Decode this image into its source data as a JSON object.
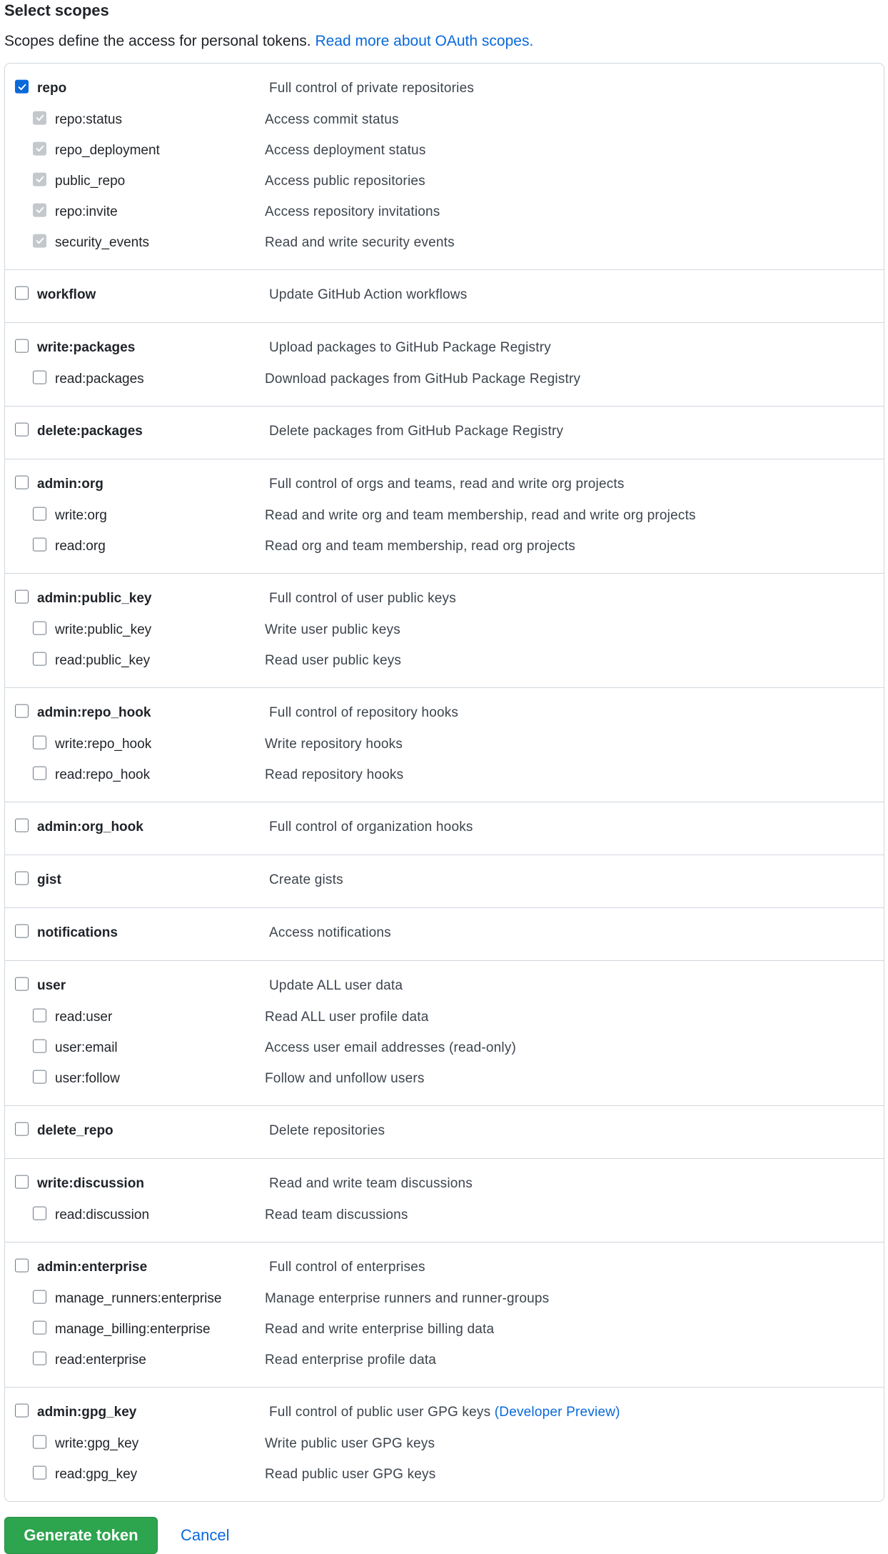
{
  "header": {
    "title": "Select scopes",
    "description": "Scopes define the access for personal tokens.",
    "link_text": "Read more about OAuth scopes."
  },
  "groups": [
    {
      "id": "repo",
      "name": "repo",
      "desc": "Full control of private repositories",
      "checked": true,
      "children": [
        {
          "name": "repo:status",
          "desc": "Access commit status",
          "state": "checked-disabled"
        },
        {
          "name": "repo_deployment",
          "desc": "Access deployment status",
          "state": "checked-disabled"
        },
        {
          "name": "public_repo",
          "desc": "Access public repositories",
          "state": "checked-disabled"
        },
        {
          "name": "repo:invite",
          "desc": "Access repository invitations",
          "state": "checked-disabled"
        },
        {
          "name": "security_events",
          "desc": "Read and write security events",
          "state": "checked-disabled"
        }
      ]
    },
    {
      "id": "workflow",
      "name": "workflow",
      "desc": "Update GitHub Action workflows",
      "checked": false,
      "children": []
    },
    {
      "id": "write-packages",
      "name": "write:packages",
      "desc": "Upload packages to GitHub Package Registry",
      "checked": false,
      "children": [
        {
          "name": "read:packages",
          "desc": "Download packages from GitHub Package Registry",
          "state": "unchecked"
        }
      ]
    },
    {
      "id": "delete-packages",
      "name": "delete:packages",
      "desc": "Delete packages from GitHub Package Registry",
      "checked": false,
      "children": []
    },
    {
      "id": "admin-org",
      "name": "admin:org",
      "desc": "Full control of orgs and teams, read and write org projects",
      "checked": false,
      "children": [
        {
          "name": "write:org",
          "desc": "Read and write org and team membership, read and write org projects",
          "state": "unchecked"
        },
        {
          "name": "read:org",
          "desc": "Read org and team membership, read org projects",
          "state": "unchecked"
        }
      ]
    },
    {
      "id": "admin-public-key",
      "name": "admin:public_key",
      "desc": "Full control of user public keys",
      "checked": false,
      "children": [
        {
          "name": "write:public_key",
          "desc": "Write user public keys",
          "state": "unchecked"
        },
        {
          "name": "read:public_key",
          "desc": "Read user public keys",
          "state": "unchecked"
        }
      ]
    },
    {
      "id": "admin-repo-hook",
      "name": "admin:repo_hook",
      "desc": "Full control of repository hooks",
      "checked": false,
      "children": [
        {
          "name": "write:repo_hook",
          "desc": "Write repository hooks",
          "state": "unchecked"
        },
        {
          "name": "read:repo_hook",
          "desc": "Read repository hooks",
          "state": "unchecked"
        }
      ]
    },
    {
      "id": "admin-org-hook",
      "name": "admin:org_hook",
      "desc": "Full control of organization hooks",
      "checked": false,
      "children": []
    },
    {
      "id": "gist",
      "name": "gist",
      "desc": "Create gists",
      "checked": false,
      "children": []
    },
    {
      "id": "notifications",
      "name": "notifications",
      "desc": "Access notifications",
      "checked": false,
      "children": []
    },
    {
      "id": "user",
      "name": "user",
      "desc": "Update ALL user data",
      "checked": false,
      "children": [
        {
          "name": "read:user",
          "desc": "Read ALL user profile data",
          "state": "unchecked"
        },
        {
          "name": "user:email",
          "desc": "Access user email addresses (read-only)",
          "state": "unchecked"
        },
        {
          "name": "user:follow",
          "desc": "Follow and unfollow users",
          "state": "unchecked"
        }
      ]
    },
    {
      "id": "delete-repo",
      "name": "delete_repo",
      "desc": "Delete repositories",
      "checked": false,
      "children": []
    },
    {
      "id": "write-discussion",
      "name": "write:discussion",
      "desc": "Read and write team discussions",
      "checked": false,
      "children": [
        {
          "name": "read:discussion",
          "desc": "Read team discussions",
          "state": "unchecked"
        }
      ]
    },
    {
      "id": "admin-enterprise",
      "name": "admin:enterprise",
      "desc": "Full control of enterprises",
      "checked": false,
      "children": [
        {
          "name": "manage_runners:enterprise",
          "desc": "Manage enterprise runners and runner-groups",
          "state": "unchecked"
        },
        {
          "name": "manage_billing:enterprise",
          "desc": "Read and write enterprise billing data",
          "state": "unchecked"
        },
        {
          "name": "read:enterprise",
          "desc": "Read enterprise profile data",
          "state": "unchecked"
        }
      ]
    },
    {
      "id": "admin-gpg-key",
      "name": "admin:gpg_key",
      "desc": "Full control of public user GPG keys",
      "desc_link": "(Developer Preview)",
      "checked": false,
      "children": [
        {
          "name": "write:gpg_key",
          "desc": "Write public user GPG keys",
          "state": "unchecked"
        },
        {
          "name": "read:gpg_key",
          "desc": "Read public user GPG keys",
          "state": "unchecked"
        }
      ]
    }
  ],
  "actions": {
    "generate_label": "Generate token",
    "cancel_label": "Cancel"
  },
  "colors": {
    "accent": "#0969da",
    "primary_button": "#2da44e",
    "border": "#d0d7de"
  }
}
